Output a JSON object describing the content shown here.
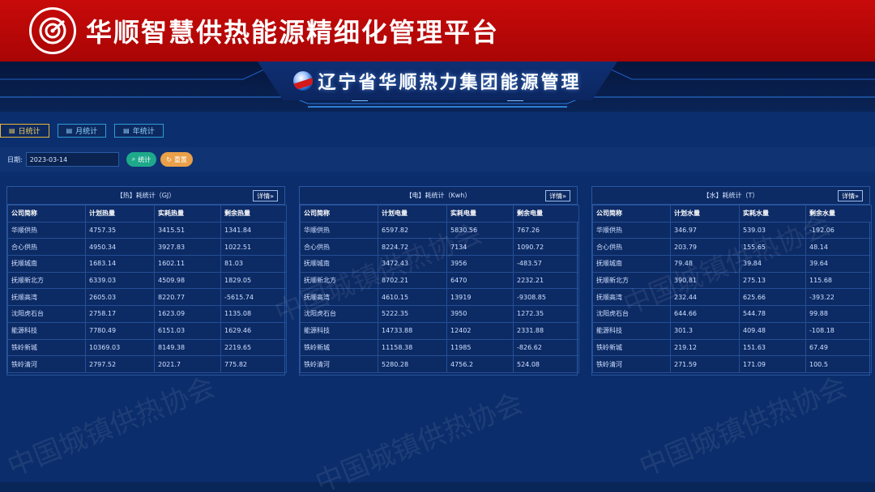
{
  "banner": {
    "title": "华顺智慧供热能源精细化管理平台"
  },
  "header": {
    "title": "辽宁省华顺热力集团能源管理"
  },
  "tabs": [
    {
      "label": "日统计"
    },
    {
      "label": "月统计"
    },
    {
      "label": "年统计"
    }
  ],
  "filter": {
    "date_label": "日期:",
    "date_value": "2023-03-14",
    "search_label": "统计",
    "reset_label": "重置"
  },
  "detail_label": "详情»",
  "watermark": "中国城镇供热协会",
  "panels": [
    {
      "title": "【热】耗统计（GJ）",
      "columns": [
        "公司简称",
        "计划热量",
        "实耗热量",
        "剩余热量"
      ],
      "rows": [
        [
          "华顺供热",
          "4757.35",
          "3415.51",
          "1341.84"
        ],
        [
          "合心供热",
          "4950.34",
          "3927.83",
          "1022.51"
        ],
        [
          "抚顺城南",
          "1683.14",
          "1602.11",
          "81.03"
        ],
        [
          "抚顺新北方",
          "6339.03",
          "4509.98",
          "1829.05"
        ],
        [
          "抚顺高湾",
          "2605.03",
          "8220.77",
          "-5615.74"
        ],
        [
          "沈阳虎石台",
          "2758.17",
          "1623.09",
          "1135.08"
        ],
        [
          "能源科技",
          "7780.49",
          "6151.03",
          "1629.46"
        ],
        [
          "铁岭新城",
          "10369.03",
          "8149.38",
          "2219.65"
        ],
        [
          "铁岭清河",
          "2797.52",
          "2021.7",
          "775.82"
        ]
      ]
    },
    {
      "title": "【电】耗统计（Kwh）",
      "columns": [
        "公司简称",
        "计划电量",
        "实耗电量",
        "剩余电量"
      ],
      "rows": [
        [
          "华顺供热",
          "6597.82",
          "5830.56",
          "767.26"
        ],
        [
          "合心供热",
          "8224.72",
          "7134",
          "1090.72"
        ],
        [
          "抚顺城南",
          "3472.43",
          "3956",
          "-483.57"
        ],
        [
          "抚顺新北方",
          "8702.21",
          "6470",
          "2232.21"
        ],
        [
          "抚顺高湾",
          "4610.15",
          "13919",
          "-9308.85"
        ],
        [
          "沈阳虎石台",
          "5222.35",
          "3950",
          "1272.35"
        ],
        [
          "能源科技",
          "14733.88",
          "12402",
          "2331.88"
        ],
        [
          "铁岭新城",
          "11158.38",
          "11985",
          "-826.62"
        ],
        [
          "铁岭清河",
          "5280.28",
          "4756.2",
          "524.08"
        ]
      ]
    },
    {
      "title": "【水】耗统计（T）",
      "columns": [
        "公司简称",
        "计划水量",
        "实耗水量",
        "剩余水量"
      ],
      "rows": [
        [
          "华顺供热",
          "346.97",
          "539.03",
          "-192.06"
        ],
        [
          "合心供热",
          "203.79",
          "155.65",
          "48.14"
        ],
        [
          "抚顺城南",
          "79.48",
          "39.84",
          "39.64"
        ],
        [
          "抚顺新北方",
          "390.81",
          "275.13",
          "115.68"
        ],
        [
          "抚顺高湾",
          "232.44",
          "625.66",
          "-393.22"
        ],
        [
          "沈阳虎石台",
          "644.66",
          "544.78",
          "99.88"
        ],
        [
          "能源科技",
          "301.3",
          "409.48",
          "-108.18"
        ],
        [
          "铁岭新城",
          "219.12",
          "151.63",
          "67.49"
        ],
        [
          "铁岭清河",
          "271.59",
          "171.09",
          "100.5"
        ]
      ]
    }
  ]
}
